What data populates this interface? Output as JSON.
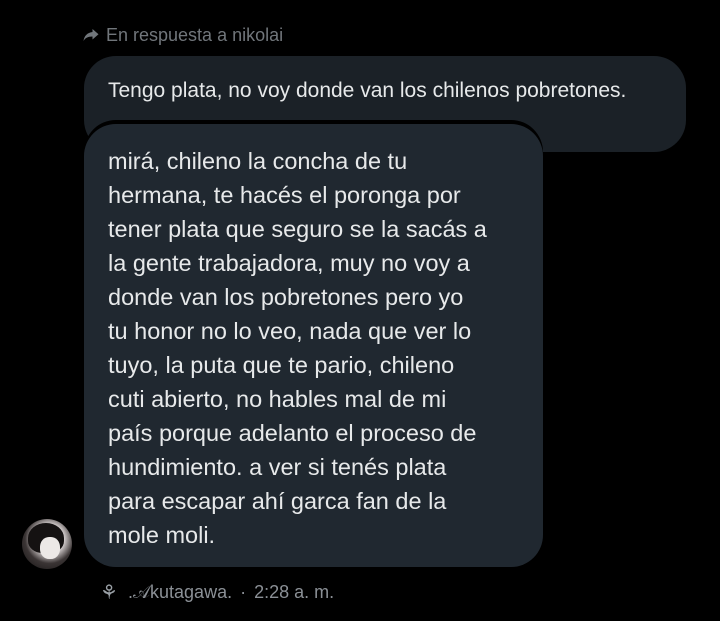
{
  "reply_header": {
    "icon": "reply-arrow-icon",
    "text": "En respuesta a nikolai"
  },
  "quoted_message": {
    "text": "Tengo plata, no voy donde van los chilenos pobretones."
  },
  "main_message": {
    "lines": [
      "mirá, chileno la concha de tu",
      "hermana, te hacés el poronga por",
      "tener plata que seguro se la sacás a",
      "la gente trabajadora, muy no voy a",
      "donde van los pobretones pero yo",
      "tu honor no lo veo, nada que ver lo",
      "tuyo, la puta que te pario, chileno",
      "cuti abierto, no hables mal de mi",
      "país porque adelanto el proceso de",
      "hundimiento. a ver si tenés plata",
      "para escapar ahí garca fan de la",
      "mole moli."
    ]
  },
  "footer": {
    "icon_glyph": "⚘",
    "author": ".𝒜kutagawa.",
    "separator": "·",
    "time": "2:28 a. m."
  },
  "colors": {
    "background": "#000000",
    "bubble": "#202830",
    "text": "#e7e9ea",
    "muted": "#71767b"
  }
}
